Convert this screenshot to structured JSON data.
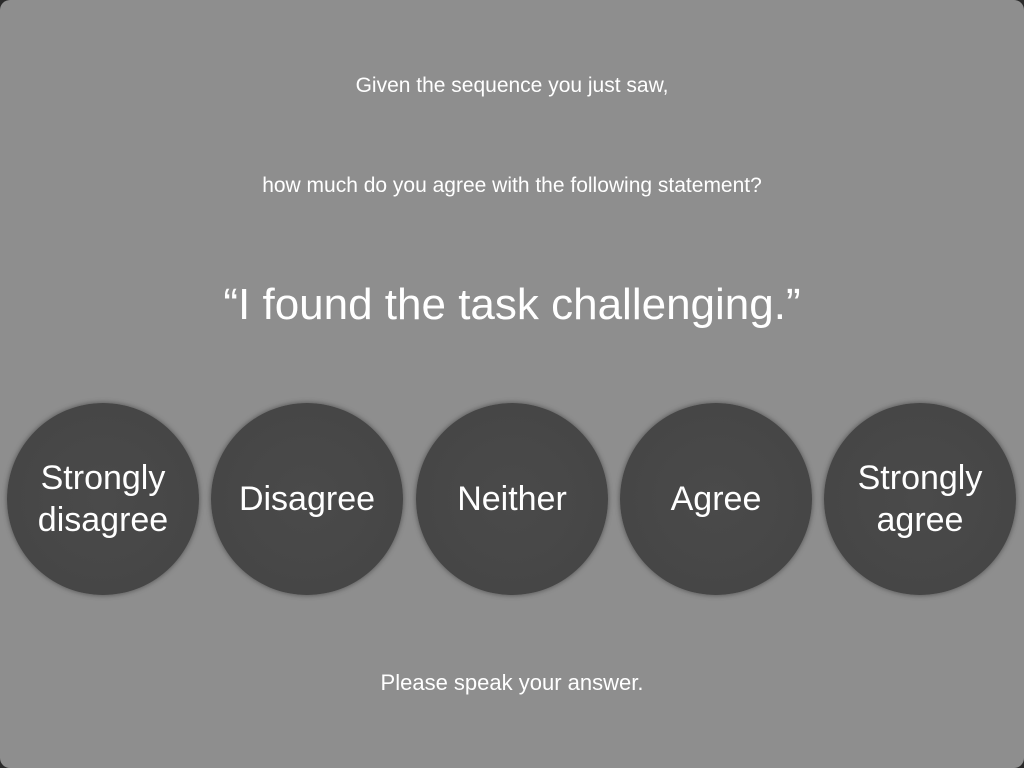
{
  "prompt": {
    "line1": "Given the sequence you just saw,",
    "line2": "how much do you agree with the following statement?"
  },
  "statement": "“I found the task challenging.”",
  "options": [
    {
      "label": "Strongly\ndisagree"
    },
    {
      "label": "Disagree"
    },
    {
      "label": "Neither"
    },
    {
      "label": "Agree"
    },
    {
      "label": "Strongly\nagree"
    }
  ],
  "footer": "Please speak your answer.",
  "colors": {
    "background": "#8e8e8e",
    "button": "#464646",
    "text": "#ffffff"
  }
}
